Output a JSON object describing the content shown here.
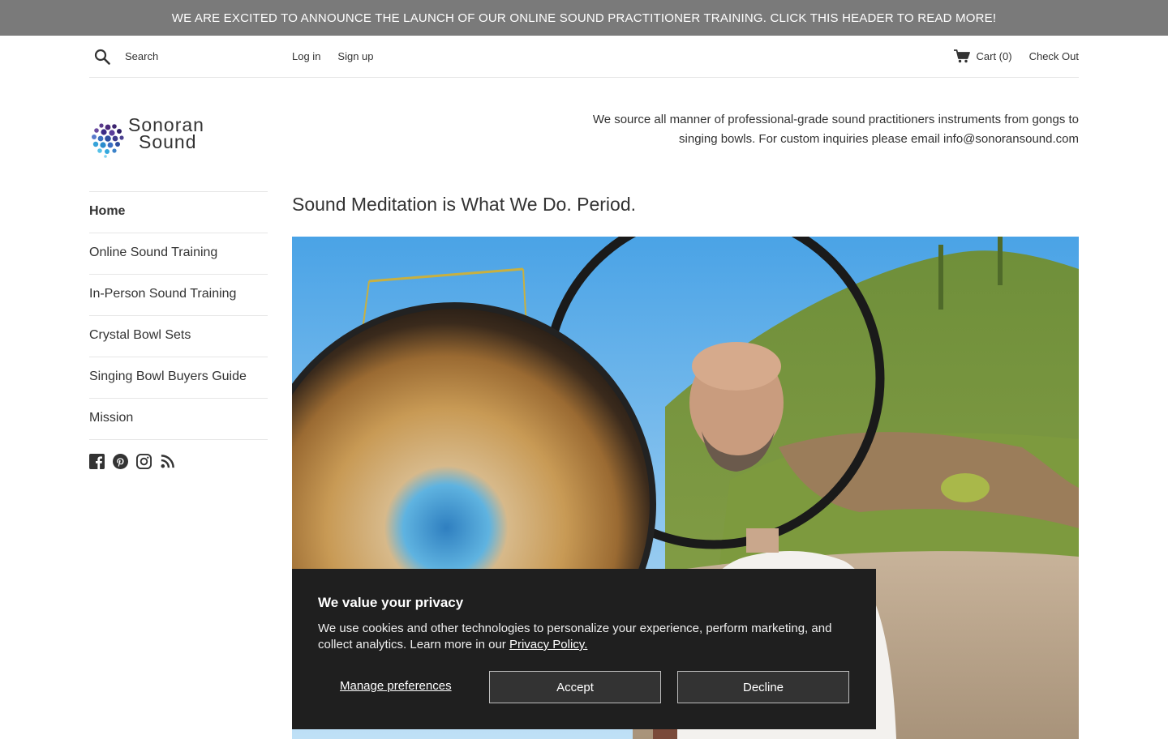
{
  "announcement": "WE ARE EXCITED TO ANNOUNCE THE LAUNCH OF OUR ONLINE SOUND PRACTITIONER TRAINING. CLICK THIS HEADER TO READ MORE!",
  "topbar": {
    "search_placeholder": "Search",
    "login": "Log in",
    "signup": "Sign up",
    "cart": "Cart (0)",
    "checkout": "Check Out"
  },
  "header": {
    "logo_line1": "Sonoran",
    "logo_line2": "Sound",
    "tagline": "We source all manner of professional-grade sound practitioners instruments from gongs to singing bowls. For custom inquiries please email info@sonoransound.com"
  },
  "sidebar": {
    "items": [
      {
        "label": "Home"
      },
      {
        "label": "Online Sound Training"
      },
      {
        "label": "In-Person Sound Training"
      },
      {
        "label": "Crystal Bowl Sets"
      },
      {
        "label": "Singing Bowl Buyers Guide"
      },
      {
        "label": "Mission"
      }
    ],
    "social": [
      "facebook-icon",
      "pinterest-icon",
      "instagram-icon",
      "rss-icon"
    ]
  },
  "main": {
    "title": "Sound Meditation is What We Do. Period."
  },
  "cookie": {
    "title": "We value your privacy",
    "body": "We use cookies and other technologies to personalize your experience, perform marketing, and collect analytics. Learn more in our ",
    "policy_link": "Privacy Policy.",
    "manage": "Manage preferences",
    "accept": "Accept",
    "decline": "Decline"
  },
  "colors": {
    "announcement_bg": "#7a7a7a",
    "cookie_bg": "#1f1f1f",
    "text": "#333333"
  }
}
